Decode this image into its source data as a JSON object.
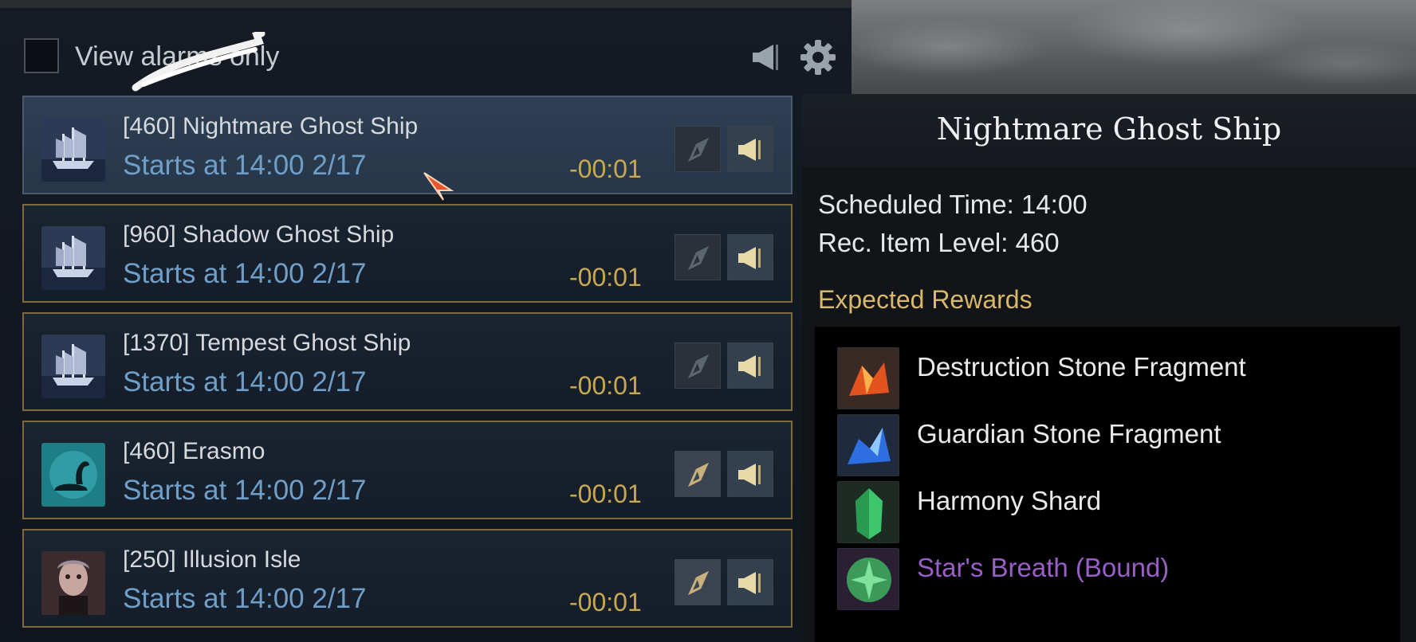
{
  "filter": {
    "label": "View alarms only"
  },
  "events": [
    {
      "name": "[460] Nightmare Ghost Ship",
      "start": "Starts at 14:00 2/17",
      "countdown": "-00:01",
      "thumb": "ghost-ship-icon",
      "selected": true
    },
    {
      "name": "[960] Shadow Ghost Ship",
      "start": "Starts at 14:00 2/17",
      "countdown": "-00:01",
      "thumb": "ghost-ship-icon",
      "selected": false
    },
    {
      "name": "[1370] Tempest Ghost Ship",
      "start": "Starts at 14:00 2/17",
      "countdown": "-00:01",
      "thumb": "ghost-ship-icon",
      "selected": false
    },
    {
      "name": "[460] Erasmo",
      "start": "Starts at 14:00 2/17",
      "countdown": "-00:01",
      "thumb": "sea-monster-icon",
      "selected": false
    },
    {
      "name": "[250] Illusion Isle",
      "start": "Starts at 14:00 2/17",
      "countdown": "-00:01",
      "thumb": "portrait-icon",
      "selected": false
    }
  ],
  "tooltip": {
    "title": "Nightmare Ghost Ship",
    "scheduled": "Scheduled Time: 14:00",
    "item_level": "Rec. Item Level: 460",
    "rewards_title": "Expected Rewards",
    "rewards": [
      {
        "name": "Destruction Stone Fragment",
        "icon": "destruction-stone-icon",
        "color": "#e8eaec"
      },
      {
        "name": "Guardian Stone Fragment",
        "icon": "guardian-stone-icon",
        "color": "#e8eaec"
      },
      {
        "name": "Harmony Shard",
        "icon": "harmony-shard-icon",
        "color": "#e8eaec"
      },
      {
        "name": "Star's Breath (Bound)",
        "icon": "stars-breath-icon",
        "color": "#9a5fc6"
      }
    ]
  },
  "colors": {
    "accent_gold": "#c9a853",
    "start_blue": "#6f9fc9",
    "row_border": "#7d6b3d",
    "rewards_title": "#d8b869",
    "bound_purple": "#9a5fc6"
  }
}
